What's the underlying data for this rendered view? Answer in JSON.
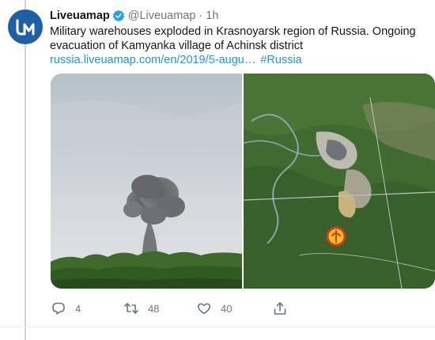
{
  "tweet": {
    "display_name": "Liveuamap",
    "handle": "@Liveuamap",
    "separator": "·",
    "time": "1h",
    "text_line1": "Military warehouses exploded in Krasnoyarsk region of Russia. Ongoing",
    "text_line2": "evacuation of Kamyanka village of Achinsk district",
    "link": "russia.liveuamap.com/en/2019/5-augu…",
    "hashtag": "#Russia"
  },
  "actions": {
    "reply_count": "4",
    "retweet_count": "48",
    "like_count": "40"
  },
  "colors": {
    "link": "#1b95e0",
    "verified": "#1da1f2",
    "avatar_bg": "#1f5fa8",
    "muted": "#657786",
    "marker_red": "#d33b24",
    "marker_yellow": "#f4c21b"
  },
  "icons": {
    "reply": "reply-icon",
    "retweet": "retweet-icon",
    "like": "heart-icon",
    "share": "share-icon",
    "verified": "verified-badge-icon"
  }
}
